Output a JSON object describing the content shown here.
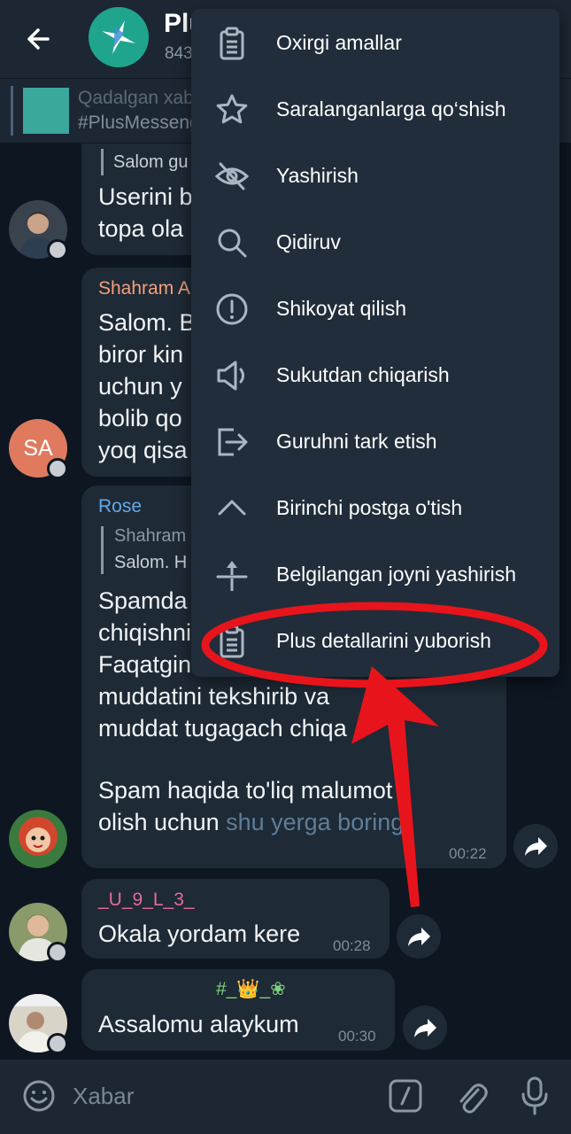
{
  "header": {
    "title": "Plus",
    "subtitle": "843"
  },
  "pinned": {
    "title": "Qadalgan xab",
    "text": "#PlusMesseng"
  },
  "messages": {
    "m1": {
      "reply": "Salom gu",
      "line1": "Userini b",
      "line2": "topa ola"
    },
    "m2": {
      "name": "Shahram A",
      "lines": [
        "Salom. B",
        "biror kin",
        "uchun y",
        "bolib qo",
        "yoq qisa"
      ],
      "avatar_initials": "SA"
    },
    "m3": {
      "name": "Rose",
      "reply_name": "Shahram",
      "reply_text": "Salom. H",
      "lines": [
        "Spamda",
        "chiqishni",
        "Faqatgina",
        "muddatini tekshirib va",
        "muddat tugagach chiqa",
        "",
        "Spam haqida to'liq malumot"
      ],
      "last_line": "olish uchun ",
      "link": "shu yerga boring",
      "time": "00:22"
    },
    "m4": {
      "name": "_U_9_L_3_",
      "text": "Okala yordam kere",
      "time": "00:28"
    },
    "m5": {
      "name": "#_👑_❀",
      "text": "Assalomu alaykum",
      "time": "00:30"
    }
  },
  "menu": {
    "items": [
      {
        "label": "Oxirgi amallar",
        "icon": "clipboard-icon"
      },
      {
        "label": "Saralanganlarga qo‘shish",
        "icon": "star-icon"
      },
      {
        "label": "Yashirish",
        "icon": "eye-off-icon"
      },
      {
        "label": "Qidiruv",
        "icon": "search-icon"
      },
      {
        "label": "Shikoyat qilish",
        "icon": "report-icon"
      },
      {
        "label": "Sukutdan chiqarish",
        "icon": "speaker-icon"
      },
      {
        "label": "Guruhni tark etish",
        "icon": "leave-icon"
      },
      {
        "label": "Birinchi postga o'tish",
        "icon": "chevron-up-icon"
      },
      {
        "label": "Belgilangan joyni yashirish",
        "icon": "unpin-icon"
      },
      {
        "label": "Plus detallarini yuborish",
        "icon": "clipboard-icon"
      }
    ]
  },
  "input": {
    "placeholder": "Xabar"
  },
  "colors": {
    "background": "#0e1621",
    "bubble": "#1e2a36",
    "menu": "#212d3a",
    "annotation": "#e8141c",
    "link": "#5e7e99"
  }
}
